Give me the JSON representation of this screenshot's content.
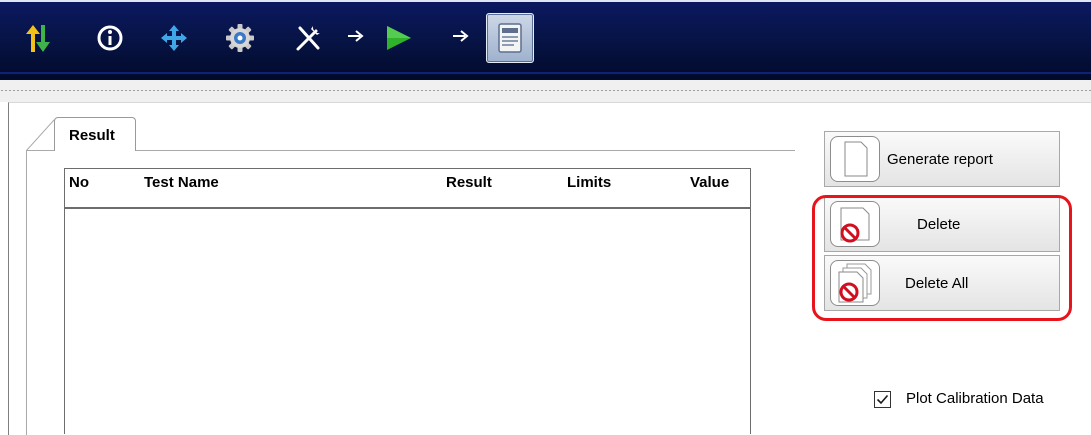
{
  "toolbar": {
    "buttons": [
      {
        "name": "transfer",
        "icon": "up-down-arrows-icon"
      },
      {
        "name": "info",
        "icon": "info-icon"
      },
      {
        "name": "center",
        "icon": "move-arrows-icon"
      },
      {
        "name": "settings",
        "icon": "gear-icon"
      },
      {
        "name": "tools",
        "icon": "tools-icon"
      },
      {
        "name": "run",
        "icon": "play-icon"
      },
      {
        "name": "report",
        "icon": "report-icon",
        "active": true
      }
    ],
    "arrow_glyph": "→"
  },
  "tab": {
    "label": "Result"
  },
  "grid": {
    "columns": [
      "No",
      "Test Name",
      "Result",
      "Limits",
      "Value"
    ],
    "rows": []
  },
  "actions": {
    "generate_report": "Generate report",
    "delete": "Delete",
    "delete_all": "Delete All"
  },
  "options": {
    "plot_calibration_label": "Plot Calibration Data",
    "plot_calibration_checked": true
  },
  "colors": {
    "toolbar_bg": "#071447",
    "highlight": "#e8141c",
    "delete_icon": "#d01020"
  }
}
